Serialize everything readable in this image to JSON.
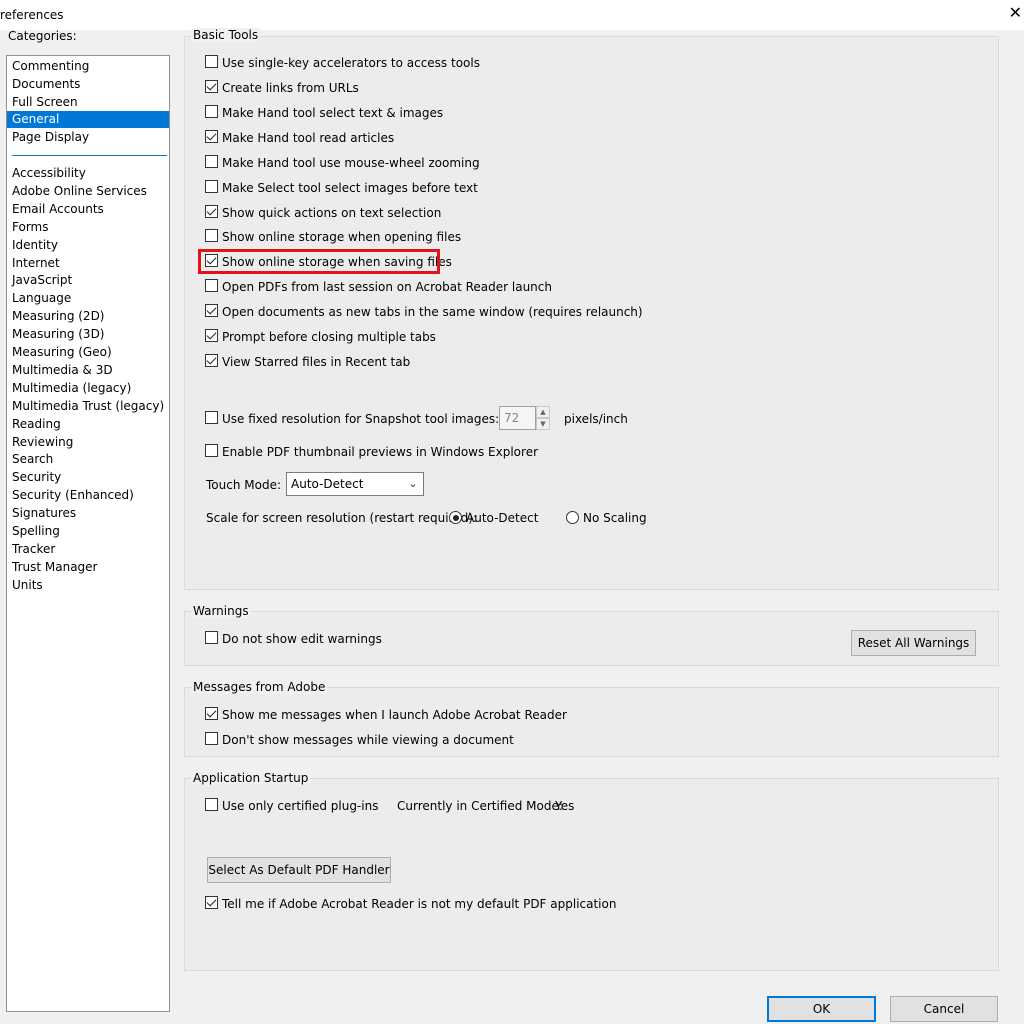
{
  "window": {
    "title": "references",
    "close_glyph": "✕"
  },
  "categories_label": "Categories:",
  "categories": {
    "top": [
      "Commenting",
      "Documents",
      "Full Screen",
      "General",
      "Page Display"
    ],
    "bottom": [
      "Accessibility",
      "Adobe Online Services",
      "Email Accounts",
      "Forms",
      "Identity",
      "Internet",
      "JavaScript",
      "Language",
      "Measuring (2D)",
      "Measuring (3D)",
      "Measuring (Geo)",
      "Multimedia & 3D",
      "Multimedia (legacy)",
      "Multimedia Trust (legacy)",
      "Reading",
      "Reviewing",
      "Search",
      "Security",
      "Security (Enhanced)",
      "Signatures",
      "Spelling",
      "Tracker",
      "Trust Manager",
      "Units"
    ],
    "selected": "General"
  },
  "basic_tools": {
    "title": "Basic Tools",
    "options": [
      {
        "label": "Use single-key accelerators to access tools",
        "checked": false
      },
      {
        "label": "Create links from URLs",
        "checked": true
      },
      {
        "label": "Make Hand tool select text & images",
        "checked": false
      },
      {
        "label": "Make Hand tool read articles",
        "checked": true
      },
      {
        "label": "Make Hand tool use mouse-wheel zooming",
        "checked": false
      },
      {
        "label": "Make Select tool select images before text",
        "checked": false
      },
      {
        "label": "Show quick actions on text selection",
        "checked": true
      },
      {
        "label": "Show online storage when opening files",
        "checked": false
      },
      {
        "label": "Show online storage when saving files",
        "checked": true
      },
      {
        "label": "Open PDFs from last session on Acrobat Reader launch",
        "checked": false
      },
      {
        "label": "Open documents as new tabs in the same window (requires relaunch)",
        "checked": true
      },
      {
        "label": "Prompt before closing multiple tabs",
        "checked": true
      },
      {
        "label": "View Starred files in Recent tab",
        "checked": true
      }
    ],
    "snapshot": {
      "label": "Use fixed resolution for Snapshot tool images:",
      "checked": false,
      "value": "72",
      "unit": "pixels/inch"
    },
    "thumbnail": {
      "label": "Enable PDF thumbnail previews in Windows Explorer",
      "checked": false
    },
    "touch_mode": {
      "label": "Touch Mode:",
      "value": "Auto-Detect"
    },
    "scale": {
      "label": "Scale for screen resolution (restart required):",
      "options": [
        {
          "label": "Auto-Detect",
          "selected": true
        },
        {
          "label": "No Scaling",
          "selected": false
        }
      ]
    }
  },
  "warnings": {
    "title": "Warnings",
    "option": {
      "label": "Do not show edit warnings",
      "checked": false
    },
    "reset_button": "Reset All Warnings"
  },
  "messages": {
    "title": "Messages from Adobe",
    "options": [
      {
        "label": "Show me messages when I launch Adobe Acrobat Reader",
        "checked": true
      },
      {
        "label": "Don't show messages while viewing a document",
        "checked": false
      }
    ]
  },
  "startup": {
    "title": "Application Startup",
    "certified": {
      "label": "Use only certified plug-ins",
      "checked": false
    },
    "certified_mode_label": "Currently in Certified Mode:",
    "certified_mode_value": "Yes",
    "default_handler_button": "Select As Default PDF Handler",
    "tell_me": {
      "label": "Tell me if Adobe Acrobat Reader is not my default PDF application",
      "checked": true
    }
  },
  "footer": {
    "ok": "OK",
    "cancel": "Cancel"
  },
  "colors": {
    "selection": "#0078d7",
    "highlight": "#e3121b"
  }
}
